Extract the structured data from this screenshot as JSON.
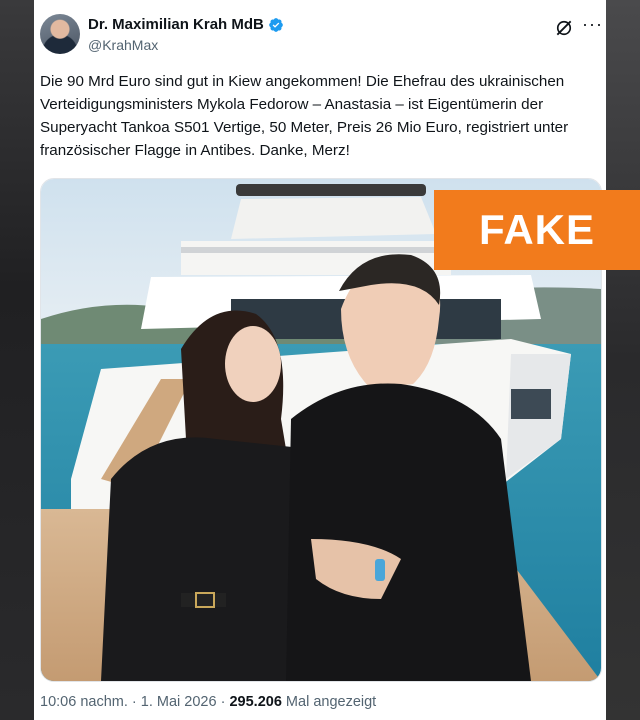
{
  "post": {
    "author_name": "Dr. Maximilian Krah MdB",
    "handle": "@KrahMax",
    "text": "Die 90 Mrd Euro sind gut in Kiew angekommen! Die Ehefrau des ukrainischen Verteidigungsministers Mykola Fedorow – Anastasia – ist Eigentümerin der Superyacht Tankoa S501 Vertige, 50 Meter, Preis 26 Mio Euro, registriert unter französischer Flagge in Antibes. Danke, Merz!",
    "time": "10:06 nachm.",
    "separator": "·",
    "date": "1. Mai 2026",
    "views_count": "295.206",
    "views_label": "Mal angezeigt"
  },
  "overlay": {
    "label": "FAKE",
    "color": "#f27b1c"
  },
  "icons": {
    "verified": "verified-badge-icon",
    "grok": "grok-icon",
    "more": "more-options-icon"
  },
  "colors": {
    "text_primary": "#0f1419",
    "text_secondary": "#536471",
    "verified_blue": "#1d9bf0"
  }
}
